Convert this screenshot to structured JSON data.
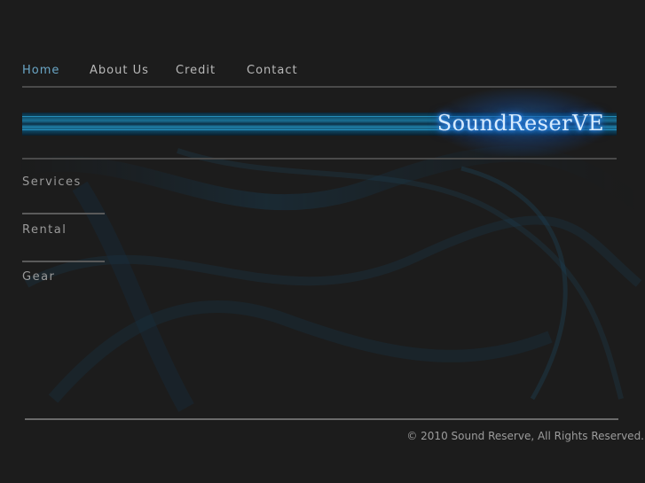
{
  "nav": {
    "items": [
      {
        "label": "Home"
      },
      {
        "label": "About Us"
      },
      {
        "label": "Credit"
      },
      {
        "label": "Contact"
      }
    ]
  },
  "banner": {
    "logo_text": "SoundReserVE"
  },
  "sidebar": {
    "items": [
      {
        "label": "Services"
      },
      {
        "label": "Rental"
      },
      {
        "label": "Gear"
      }
    ]
  },
  "footer": {
    "copyright": "© 2010 Sound Reserve, All Rights Reserved."
  },
  "colors": {
    "background": "#1c1c1c",
    "active_nav": "#6aa6c6",
    "accent_blue": "#1f7fa8"
  }
}
